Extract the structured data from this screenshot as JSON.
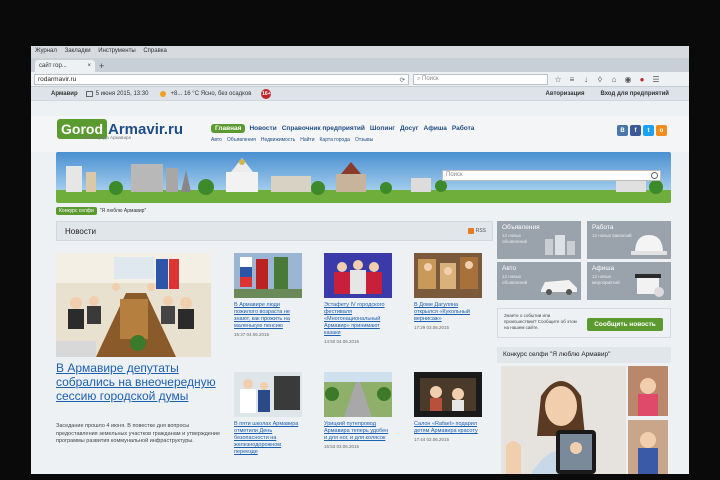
{
  "browser": {
    "menu": [
      "Журнал",
      "Закладки",
      "Инструменты",
      "Справка"
    ],
    "tab_title": "сайт гор...",
    "tab_close": "×",
    "new_tab": "+",
    "url": "rodarmavir.ru",
    "search_placeholder": "Поиск"
  },
  "topstrip": {
    "city": "Армавир",
    "date": "5 июня 2015, 13:30",
    "weather": "+8... 16 °С Ясно, без осадков",
    "age": "16+",
    "auth": "Авторизация",
    "biz": "Вход для предприятий"
  },
  "logo": {
    "left": "Gorod",
    "right": "Armavir.ru",
    "sub": "Сайт города Армавира"
  },
  "nav": {
    "items": [
      "Главная",
      "Новости",
      "Справочник предприятий",
      "Шопинг",
      "Досуг",
      "Афиша",
      "Работа"
    ],
    "sub": [
      "Авто",
      "Объявления",
      "Недвижимость",
      "Найти",
      "Карта города",
      "Отзывы"
    ]
  },
  "social": [
    "В",
    "f",
    "t",
    "о"
  ],
  "banner": {
    "search_placeholder": "Поиск"
  },
  "contest": {
    "tag": "Конкурс селфи",
    "text": "\"Я люблю Армавир\""
  },
  "news": {
    "heading": "Новости",
    "rss": "RSS",
    "main": {
      "title": "В Армавире депутаты собрались на внеочередную сессию городской думы",
      "text": "Заседание прошло 4 июня. В повестке дня вопросы предоставления земельных участков гражданам и утверждение программы развития коммунальной инфраструктуры."
    },
    "items": [
      {
        "title": "В Армавире люди пожилого возраста не знают, как прожить на маленькую пенсию",
        "date": "16:37 04.06.2015"
      },
      {
        "title": "Эстафету IV городского фестиваля «Многонациональный Армавир» принимают казаки",
        "date": "14:50 04.06.2015"
      },
      {
        "title": "В Доме Дагуляна открылся «Кукольный вернисаж»",
        "date": "17:29 03.06.2015"
      },
      {
        "title": "В пяти школах Армавира отметили День безопасности на железнодорожном переезде",
        "date": ""
      },
      {
        "title": "Урицкий путепровод Армавира теперь удобен и для ног, и для колясок",
        "date": "16:53 03.06.2015"
      },
      {
        "title": "Салон «Rafael» подарил детям Армавира красоту",
        "date": "17:44 02.06.2015"
      }
    ]
  },
  "categories": [
    {
      "label": "Объявления",
      "count": "12 новых объявлений"
    },
    {
      "label": "Работа",
      "count": "12 новых вакансий"
    },
    {
      "label": "Авто",
      "count": "12 новых объявлений"
    },
    {
      "label": "Афиша",
      "count": "12 новых мероприятий"
    }
  ],
  "event": {
    "question": "Знаете о событии или происшествии? Сообщите об этом на нашем сайте.",
    "button": "Сообщить новость"
  },
  "selfie": {
    "heading": "Конкурс селфи \"Я люблю Армавир\""
  },
  "colors": {
    "accent_green": "#5a9a2f",
    "link_blue": "#1b5fb0",
    "logo_blue": "#1f4e86",
    "badge_red": "#c0272d"
  }
}
